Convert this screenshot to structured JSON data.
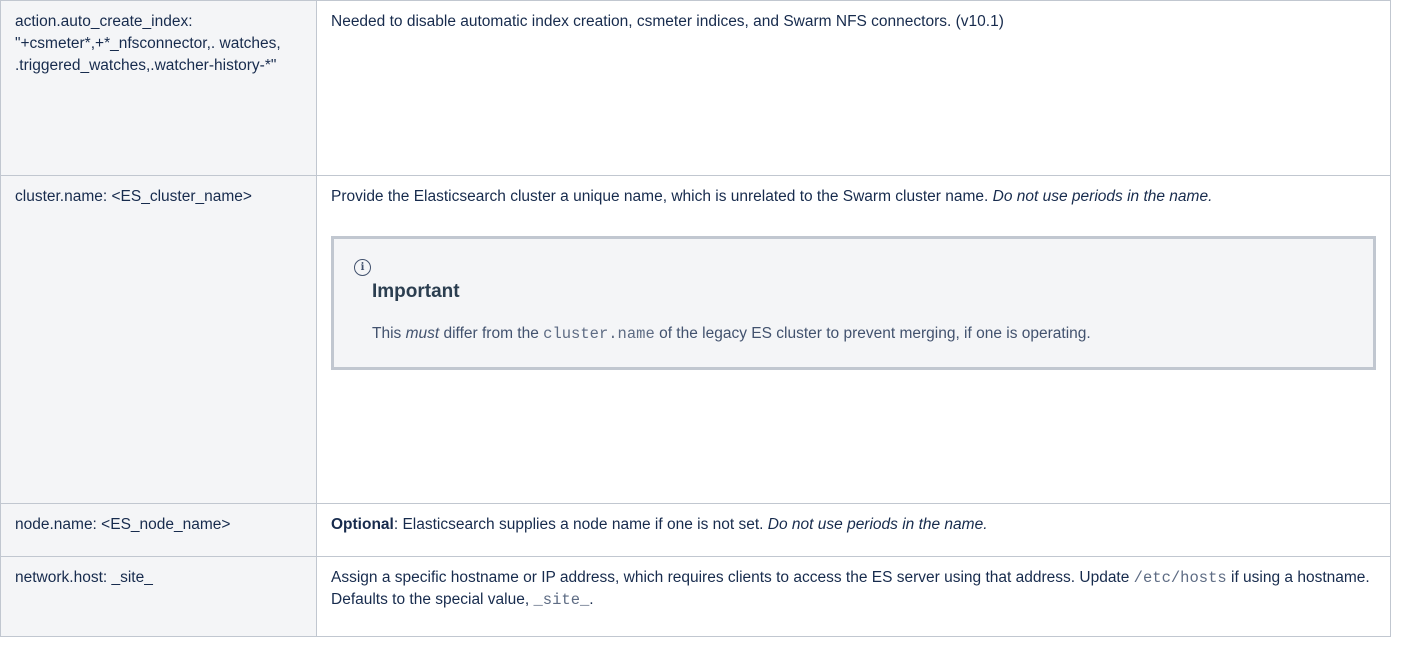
{
  "rows": [
    {
      "key": "action.auto_create_index: \"+csmeter*,+*_nfsconnector,. watches, .triggered_watches,.watcher-history-*\"",
      "description": "Needed to disable automatic index creation, csmeter indices, and Swarm NFS connectors. (v10.1)"
    },
    {
      "key": "cluster.name: <ES_cluster_name>",
      "description": "Provide the Elasticsearch cluster a unique name, which is unrelated to the Swarm cluster name. ",
      "description_italic": "Do not use periods in the name.",
      "note": {
        "icon": "info-icon",
        "title": "Important",
        "body_pre": "This ",
        "body_em": "must",
        "body_mid": " differ from the ",
        "body_code": "cluster.name",
        "body_post": " of the legacy ES cluster to prevent merging, if one is operating."
      }
    },
    {
      "key": "node.name: <ES_node_name>",
      "description_bold": "Optional",
      "description": ": Elasticsearch supplies a node name if one is not set. ",
      "description_italic": "Do not use periods in the name."
    },
    {
      "key": "network.host: _site_",
      "description_pre": "Assign a specific hostname or IP address, which requires clients to access the ES server using that address. Update ",
      "description_code1": "/etc/hosts",
      "description_mid": " if using a hostname. Defaults to the special value, ",
      "description_code2": "_site_",
      "description_post": "."
    }
  ]
}
